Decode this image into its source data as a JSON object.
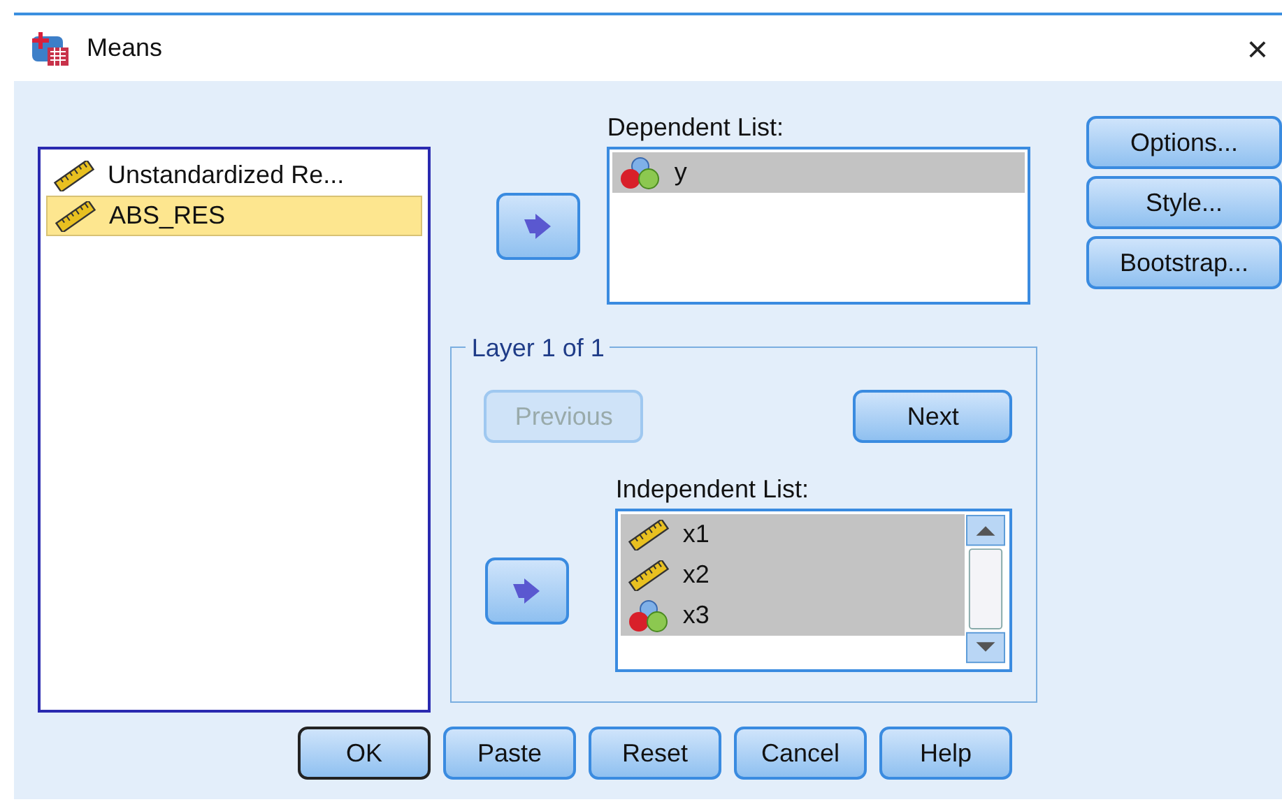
{
  "window": {
    "title": "Means",
    "close": "×"
  },
  "source_list": {
    "items": [
      {
        "label": "Unstandardized Re...",
        "kind": "scale",
        "selected": false
      },
      {
        "label": "ABS_RES",
        "kind": "scale",
        "selected": true
      }
    ]
  },
  "dependent_list": {
    "label": "Dependent List:",
    "items": [
      {
        "label": "y",
        "kind": "nominal",
        "selected": true
      }
    ]
  },
  "side_buttons": [
    {
      "label": "Options..."
    },
    {
      "label": "Style..."
    },
    {
      "label": "Bootstrap..."
    }
  ],
  "layer": {
    "title": "Layer 1 of 1",
    "previous": {
      "label": "Previous",
      "disabled": true
    },
    "next": {
      "label": "Next",
      "disabled": false
    },
    "independent_list": {
      "label": "Independent List:",
      "items": [
        {
          "label": "x1",
          "kind": "scale",
          "selected": true
        },
        {
          "label": "x2",
          "kind": "scale",
          "selected": true
        },
        {
          "label": "x3",
          "kind": "nominal",
          "selected": true
        }
      ]
    }
  },
  "buttons": [
    {
      "label": "OK",
      "default": true
    },
    {
      "label": "Paste",
      "default": false
    },
    {
      "label": "Reset",
      "default": false
    },
    {
      "label": "Cancel",
      "default": false
    },
    {
      "label": "Help",
      "default": false
    }
  ]
}
